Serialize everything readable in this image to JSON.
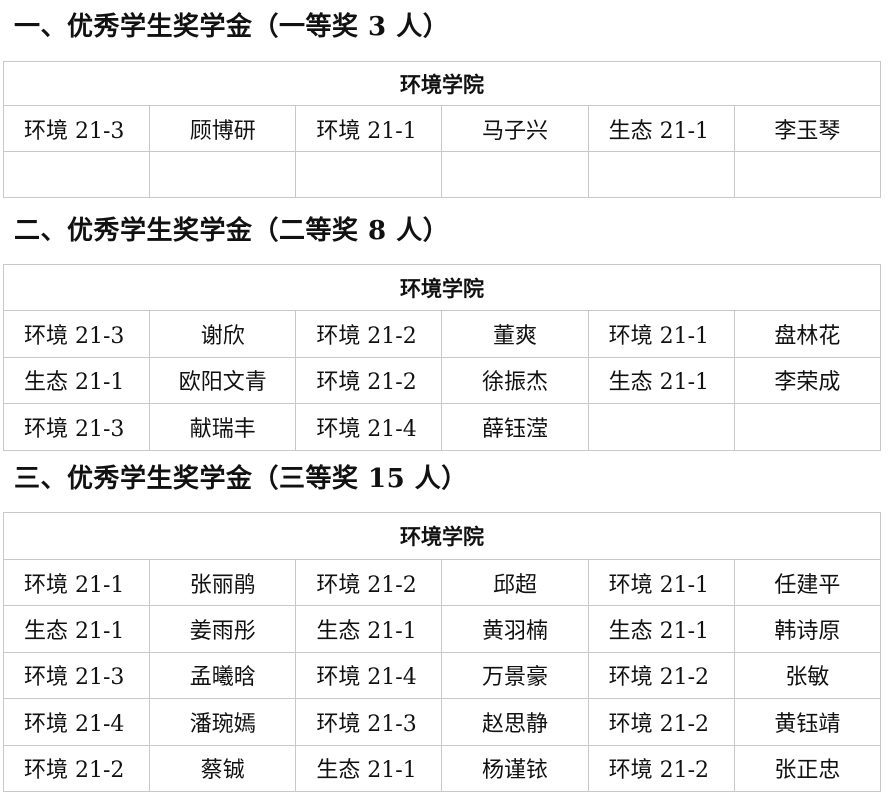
{
  "sections": [
    {
      "title": "一、优秀学生奖学金（一等奖 3  人）",
      "college": "环境学院",
      "rows": [
        [
          {
            "cls": "环境 21-3",
            "name": "顾博研"
          },
          {
            "cls": "环境 21-1",
            "name": "马子兴"
          },
          {
            "cls": "生态 21-1",
            "name": "李玉琴"
          }
        ],
        [
          {
            "cls": "",
            "name": ""
          },
          {
            "cls": "",
            "name": ""
          },
          {
            "cls": "",
            "name": ""
          }
        ]
      ]
    },
    {
      "title": "二、优秀学生奖学金（二等奖 8  人）",
      "college": "环境学院",
      "rows": [
        [
          {
            "cls": "环境 21-3",
            "name": "谢欣"
          },
          {
            "cls": "环境 21-2",
            "name": "董爽"
          },
          {
            "cls": "环境 21-1",
            "name": "盘林花"
          }
        ],
        [
          {
            "cls": "生态 21-1",
            "name": "欧阳文青"
          },
          {
            "cls": "环境 21-2",
            "name": "徐振杰"
          },
          {
            "cls": "生态 21-1",
            "name": "李荣成"
          }
        ],
        [
          {
            "cls": "环境 21-3",
            "name": "献瑞丰"
          },
          {
            "cls": "环境 21-4",
            "name": "薛钰滢"
          },
          {
            "cls": "",
            "name": ""
          }
        ]
      ]
    },
    {
      "title": "三、优秀学生奖学金（三等奖 15  人）",
      "college": "环境学院",
      "rows": [
        [
          {
            "cls": "环境 21-1",
            "name": "张丽鹃"
          },
          {
            "cls": "环境 21-2",
            "name": "邱超"
          },
          {
            "cls": "环境 21-1",
            "name": "任建平"
          }
        ],
        [
          {
            "cls": "生态 21-1",
            "name": "姜雨彤"
          },
          {
            "cls": "生态 21-1",
            "name": "黄羽楠"
          },
          {
            "cls": "生态 21-1",
            "name": "韩诗原"
          }
        ],
        [
          {
            "cls": "环境 21-3",
            "name": "孟曦晗"
          },
          {
            "cls": "环境 21-4",
            "name": "万景豪"
          },
          {
            "cls": "环境 21-2",
            "name": "张敏"
          }
        ],
        [
          {
            "cls": "环境 21-4",
            "name": "潘琬嫣"
          },
          {
            "cls": "环境 21-3",
            "name": "赵思静"
          },
          {
            "cls": "环境 21-2",
            "name": "黄钰靖"
          }
        ],
        [
          {
            "cls": "环境 21-2",
            "name": "蔡铖"
          },
          {
            "cls": "生态 21-1",
            "name": "杨谨铱"
          },
          {
            "cls": "环境 21-2",
            "name": "张正忠"
          }
        ]
      ]
    }
  ]
}
